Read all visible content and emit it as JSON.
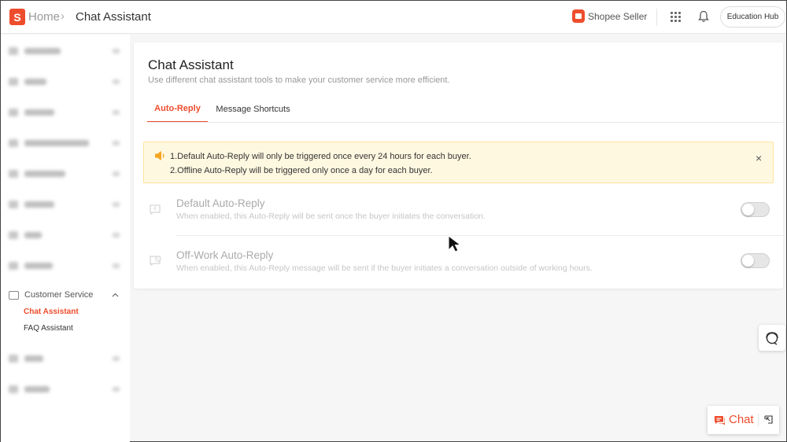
{
  "topbar": {
    "logo_letter": "S",
    "breadcrumb_home": "Home",
    "breadcrumb_sep": "›",
    "breadcrumb_current": "Chat Assistant",
    "seller_label": "Shopee Seller",
    "education_hub": "Education Hub"
  },
  "sidebar": {
    "customer_service_label": "Customer Service",
    "sub_items": [
      "Chat Assistant",
      "FAQ Assistant"
    ],
    "active_item": "Chat Assistant"
  },
  "main": {
    "title": "Chat Assistant",
    "subtitle": "Use different chat assistant tools to make your customer service more efficient.",
    "tabs": [
      {
        "label": "Auto-Reply",
        "active": true
      },
      {
        "label": "Message Shortcuts",
        "active": false
      }
    ],
    "notice": {
      "line1": "1.Default Auto-Reply will only be triggered once every 24 hours for each buyer.",
      "line2": "2.Offline Auto-Reply will be triggered only once a day for each buyer.",
      "close": "×"
    },
    "rows": [
      {
        "title": "Default Auto-Reply",
        "desc": "When enabled, this Auto-Reply will be sent once the buyer initiates the conversation.",
        "enabled": false
      },
      {
        "title": "Off-Work Auto-Reply",
        "desc": "When enabled, this Auto-Reply message will be sent if the buyer initiates a conversation outside of working hours.",
        "enabled": false
      }
    ]
  },
  "floating": {
    "chat_label": "Chat"
  },
  "colors": {
    "accent": "#ee4d2d",
    "notice_bg": "#fff8e1",
    "notice_border": "#ffe29a",
    "page_bg": "#f6f6f6"
  },
  "icons": [
    "shopee-logo-icon",
    "grid-apps-icon",
    "bell-icon",
    "customer-service-icon",
    "chevron-up-icon",
    "speaker-icon",
    "close-icon",
    "auto-reply-icon",
    "clock-reply-icon",
    "headset-icon",
    "chat-icon",
    "expand-icon"
  ]
}
